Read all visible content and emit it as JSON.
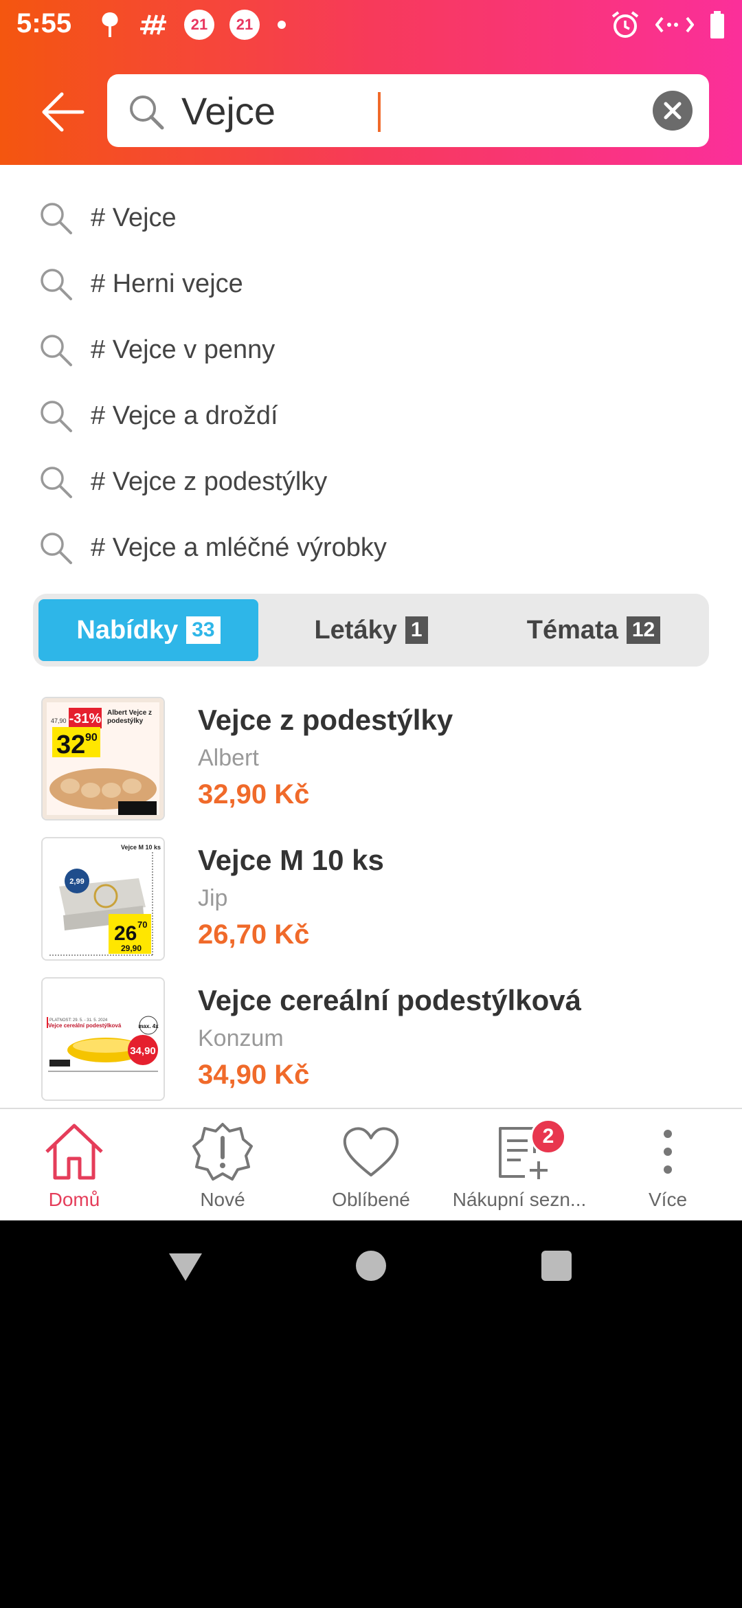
{
  "status": {
    "time": "5:55",
    "badge_a": "21",
    "badge_b": "21"
  },
  "search": {
    "query": "Vejce"
  },
  "suggestions": [
    {
      "label": "# Vejce"
    },
    {
      "label": "# Herni vejce"
    },
    {
      "label": "# Vejce v penny"
    },
    {
      "label": "# Vejce a droždí"
    },
    {
      "label": "# Vejce z podestýlky"
    },
    {
      "label": "# Vejce a mléčné výrobky"
    }
  ],
  "tabs": [
    {
      "label": "Nabídky",
      "count": "33",
      "active": true
    },
    {
      "label": "Letáky",
      "count": "1",
      "active": false
    },
    {
      "label": "Témata",
      "count": "12",
      "active": false
    }
  ],
  "offers": [
    {
      "title": "Vejce z podestýlky",
      "store": "Albert",
      "price": "32,90 Kč",
      "thumb": {
        "discount": "-31%",
        "price_int": "32",
        "price_dec": "90",
        "old_price": "47,90",
        "caption": "Albert Vejce z podestýlky"
      }
    },
    {
      "title": "Vejce M 10 ks",
      "store": "Jip",
      "price": "26,70 Kč",
      "thumb": {
        "caption": "Vejce M 10 ks",
        "unit_price": "2,99",
        "price_int": "26",
        "price_dec": "70",
        "old_price": "29,90"
      }
    },
    {
      "title": "Vejce cereální podestýlková",
      "store": "Konzum",
      "price": "34,90 Kč",
      "thumb": {
        "caption": "Vejce cereální podestýlková",
        "validity": "PLATNOST: 29. 5. - 31. 5. 2024",
        "badge": "max. 4x",
        "price": "34,90"
      }
    }
  ],
  "bottom_nav": [
    {
      "label": "Domů",
      "icon": "home-icon",
      "active": true
    },
    {
      "label": "Nové",
      "icon": "alert-badge-icon",
      "active": false
    },
    {
      "label": "Oblíbené",
      "icon": "heart-icon",
      "active": false
    },
    {
      "label": "Nákupní sezn...",
      "icon": "shopping-list-icon",
      "active": false,
      "badge": "2"
    },
    {
      "label": "Více",
      "icon": "more-vertical-icon",
      "active": false
    }
  ],
  "colors": {
    "accent_orange": "#f06a2a",
    "tab_active": "#2eb6e8",
    "nav_active": "#e53d5a"
  }
}
